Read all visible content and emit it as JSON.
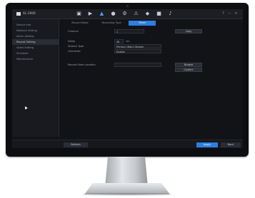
{
  "app": {
    "device_name": "XL-2000"
  },
  "topbar": {
    "icons": [
      "camera-icon",
      "playback-icon",
      "network-icon",
      "record-icon",
      "settings-icon",
      "alarm-icon",
      "storage-icon",
      "display-icon",
      "audio-icon"
    ],
    "window_buttons": [
      "help-icon",
      "minimize-icon",
      "close-icon"
    ]
  },
  "sidebar": {
    "items": [
      {
        "label": "Device Info"
      },
      {
        "label": "Network Setting"
      },
      {
        "label": "Alarm Setting"
      },
      {
        "label": "Record Setting"
      },
      {
        "label": "Video Setting"
      },
      {
        "label": "Schedule"
      },
      {
        "label": "Maintenance"
      }
    ],
    "active_index": 3
  },
  "tabs": {
    "items": [
      {
        "label": "Record Mode"
      },
      {
        "label": "Recording Type"
      },
      {
        "label": "Timer"
      }
    ],
    "active_index": 2
  },
  "form": {
    "channel_label": "Channel",
    "channel_value": "1",
    "copy_label": "Copy",
    "delay_label": "Delay",
    "delay_value": "30",
    "delay_unit": "sec",
    "stream_label": "Stream Type",
    "stream_value": "Primary (Main) Stream",
    "overwrite_label": "Overwrite",
    "overwrite_value": "Enable",
    "path_label": "Record Save Location",
    "path_value": "",
    "browse_label": "Browse",
    "confirm_label": "Confirm"
  },
  "bottom": {
    "refresh_label": "Refresh",
    "apply_label": "Apply",
    "back_label": "Back"
  },
  "colors": {
    "accent": "#2d7fe0"
  }
}
